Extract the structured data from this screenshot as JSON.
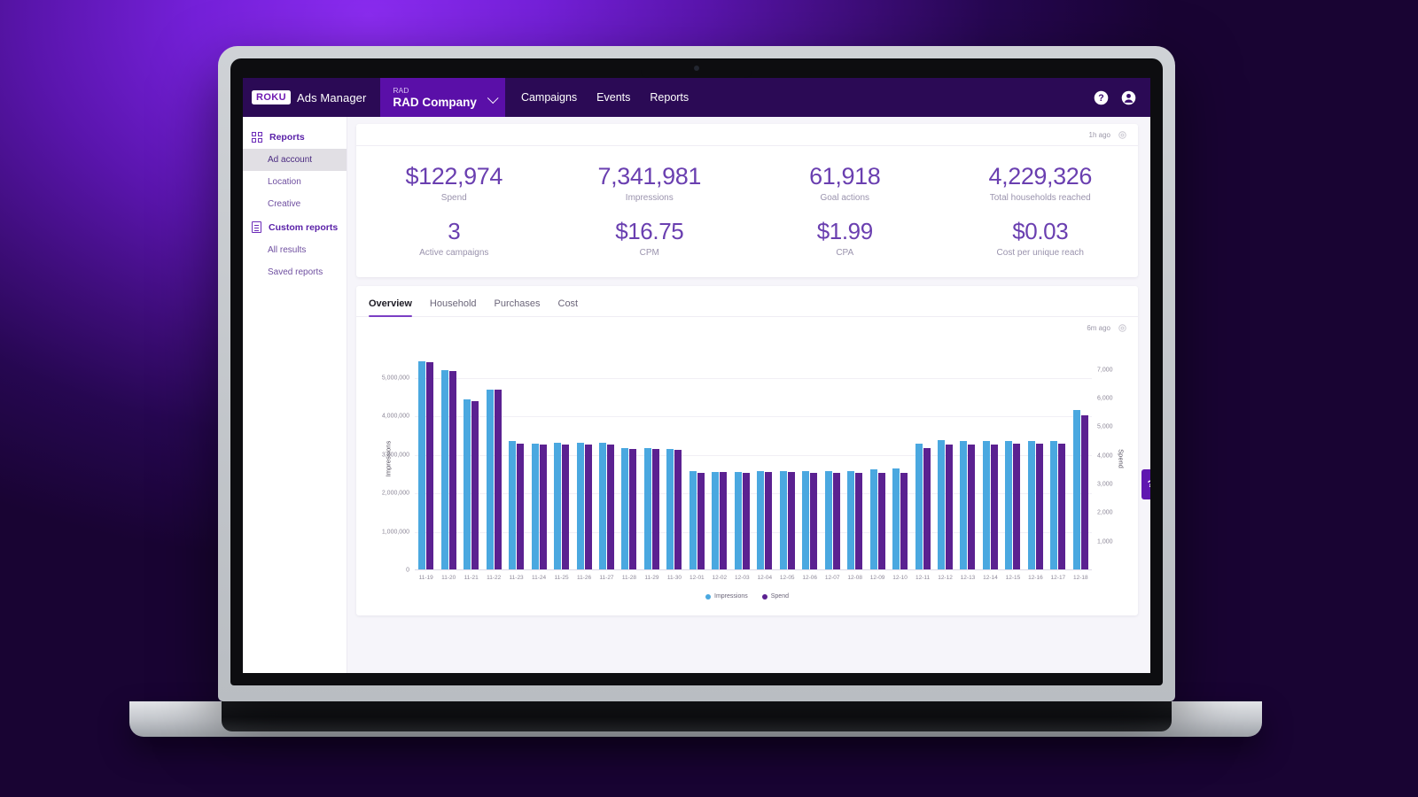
{
  "header": {
    "brand_logo": "ROKU",
    "brand_name": "Ads Manager",
    "account_sub": "RAD",
    "account_name": "RAD Company",
    "chevron_icon": "chevron-down-icon",
    "nav": [
      {
        "label": "Campaigns"
      },
      {
        "label": "Events"
      },
      {
        "label": "Reports"
      }
    ],
    "help_icon": "help-circle-icon",
    "account_icon": "user-circle-icon"
  },
  "sidebar": {
    "groups": [
      {
        "icon": "grid-icon",
        "label": "Reports",
        "items": [
          {
            "label": "Ad account",
            "active": true
          },
          {
            "label": "Location",
            "active": false
          },
          {
            "label": "Creative",
            "active": false
          }
        ]
      },
      {
        "icon": "document-icon",
        "label": "Custom reports",
        "items": [
          {
            "label": "All results",
            "active": false
          },
          {
            "label": "Saved reports",
            "active": false
          }
        ]
      }
    ]
  },
  "kpi_card": {
    "updated": "1h ago",
    "settings_icon": "gear-icon",
    "row1": [
      {
        "value": "$122,974",
        "label": "Spend"
      },
      {
        "value": "7,341,981",
        "label": "Impressions"
      },
      {
        "value": "61,918",
        "label": "Goal actions"
      },
      {
        "value": "4,229,326",
        "label": "Total households reached"
      }
    ],
    "row2": [
      {
        "value": "3",
        "label": "Active campaigns"
      },
      {
        "value": "$16.75",
        "label": "CPM"
      },
      {
        "value": "$1.99",
        "label": "CPA"
      },
      {
        "value": "$0.03",
        "label": "Cost per unique reach"
      }
    ]
  },
  "chart_card": {
    "tabs": [
      {
        "label": "Overview",
        "active": true
      },
      {
        "label": "Household",
        "active": false
      },
      {
        "label": "Purchases",
        "active": false
      },
      {
        "label": "Cost",
        "active": false
      }
    ],
    "updated": "6m ago",
    "settings_icon": "gear-icon"
  },
  "help_tab": {
    "label": "?"
  },
  "colors": {
    "brand_purple": "#2b0a55",
    "account_purple": "#5a0fa8",
    "accent_purple": "#6a3fb0",
    "impressions": "#4aa8e0",
    "spend": "#5b2191"
  },
  "chart_data": {
    "type": "bar",
    "title": "",
    "xlabel": "",
    "ylabel": "Impressions",
    "y2label": "Spend",
    "ylim": [
      0,
      5800000
    ],
    "y2lim": [
      0,
      7800
    ],
    "yticks": [
      "0",
      "1,000,000",
      "2,000,000",
      "3,000,000",
      "4,000,000",
      "5,000,000"
    ],
    "ytick_values": [
      0,
      1000000,
      2000000,
      3000000,
      4000000,
      5000000
    ],
    "y2ticks": [
      "1,000",
      "2,000",
      "3,000",
      "4,000",
      "5,000",
      "6,000",
      "7,000"
    ],
    "y2tick_values": [
      1000,
      2000,
      3000,
      4000,
      5000,
      6000,
      7000
    ],
    "grid": true,
    "legend_position": "bottom",
    "legend": [
      "Impressions",
      "Spend"
    ],
    "categories": [
      "11-19",
      "11-20",
      "11-21",
      "11-22",
      "11-23",
      "11-24",
      "11-25",
      "11-26",
      "11-27",
      "11-28",
      "11-29",
      "11-30",
      "12-01",
      "12-02",
      "12-03",
      "12-04",
      "12-05",
      "12-06",
      "12-07",
      "12-08",
      "12-09",
      "12-10",
      "12-11",
      "12-12",
      "12-13",
      "12-14",
      "12-15",
      "12-16",
      "12-17",
      "12-18"
    ],
    "series": [
      {
        "name": "Impressions",
        "color": "#4aa8e0",
        "axis": "left",
        "values": [
          5430000,
          5200000,
          4450000,
          4700000,
          3360000,
          3300000,
          3320000,
          3310000,
          3310000,
          3180000,
          3180000,
          3160000,
          2570000,
          2560000,
          2550000,
          2570000,
          2570000,
          2580000,
          2580000,
          2580000,
          2620000,
          2640000,
          3290000,
          3380000,
          3370000,
          3370000,
          3370000,
          3370000,
          3370000,
          4170000
        ]
      },
      {
        "name": "Spend",
        "color": "#5b2191",
        "axis": "right",
        "values": [
          7280,
          6980,
          5900,
          6300,
          4430,
          4400,
          4400,
          4410,
          4400,
          4240,
          4230,
          4220,
          3420,
          3430,
          3400,
          3430,
          3430,
          3420,
          3420,
          3420,
          3410,
          3410,
          4280,
          4410,
          4410,
          4410,
          4420,
          4420,
          4420,
          5410
        ]
      }
    ]
  }
}
